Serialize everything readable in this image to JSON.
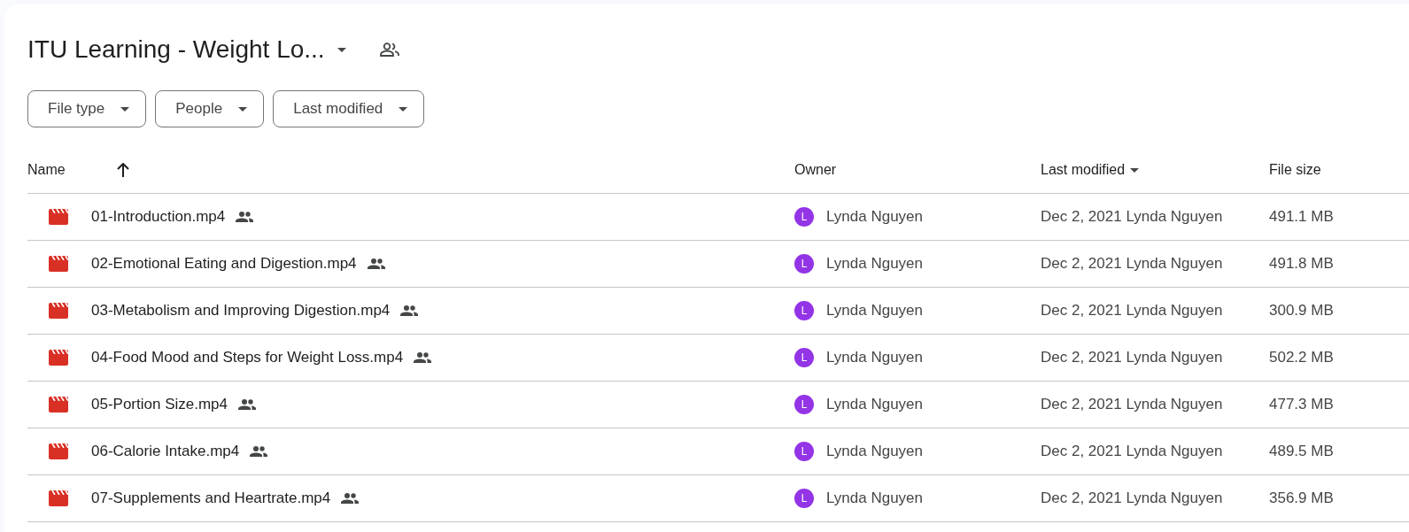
{
  "folder": {
    "title": "ITU Learning - Weight Lo..."
  },
  "filters": [
    {
      "label": "File type"
    },
    {
      "label": "People"
    },
    {
      "label": "Last modified"
    }
  ],
  "table": {
    "columns": [
      {
        "label": "Name",
        "kind": "sortasc"
      },
      {
        "label": "Owner",
        "kind": "plain"
      },
      {
        "label": "Last modified",
        "kind": "sortdesc"
      },
      {
        "label": "File size",
        "kind": "plain"
      }
    ],
    "rows": [
      {
        "name": "01-Introduction.mp4",
        "shared": true,
        "avatar": "L",
        "owner": "Lynda Nguyen",
        "modified": "Dec 2, 2021 Lynda Nguyen",
        "size": "491.1 MB"
      },
      {
        "name": "02-Emotional Eating and Digestion.mp4",
        "shared": true,
        "avatar": "L",
        "owner": "Lynda Nguyen",
        "modified": "Dec 2, 2021 Lynda Nguyen",
        "size": "491.8 MB"
      },
      {
        "name": "03-Metabolism and Improving Digestion.mp4",
        "shared": true,
        "avatar": "L",
        "owner": "Lynda Nguyen",
        "modified": "Dec 2, 2021 Lynda Nguyen",
        "size": "300.9 MB"
      },
      {
        "name": "04-Food Mood and Steps for Weight Loss.mp4",
        "shared": true,
        "avatar": "L",
        "owner": "Lynda Nguyen",
        "modified": "Dec 2, 2021 Lynda Nguyen",
        "size": "502.2 MB"
      },
      {
        "name": "05-Portion Size.mp4",
        "shared": true,
        "avatar": "L",
        "owner": "Lynda Nguyen",
        "modified": "Dec 2, 2021 Lynda Nguyen",
        "size": "477.3 MB"
      },
      {
        "name": "06-Calorie Intake.mp4",
        "shared": true,
        "avatar": "L",
        "owner": "Lynda Nguyen",
        "modified": "Dec 2, 2021 Lynda Nguyen",
        "size": "489.5 MB"
      },
      {
        "name": "07-Supplements and Heartrate.mp4",
        "shared": true,
        "avatar": "L",
        "owner": "Lynda Nguyen",
        "modified": "Dec 2, 2021 Lynda Nguyen",
        "size": "356.9 MB"
      }
    ]
  }
}
